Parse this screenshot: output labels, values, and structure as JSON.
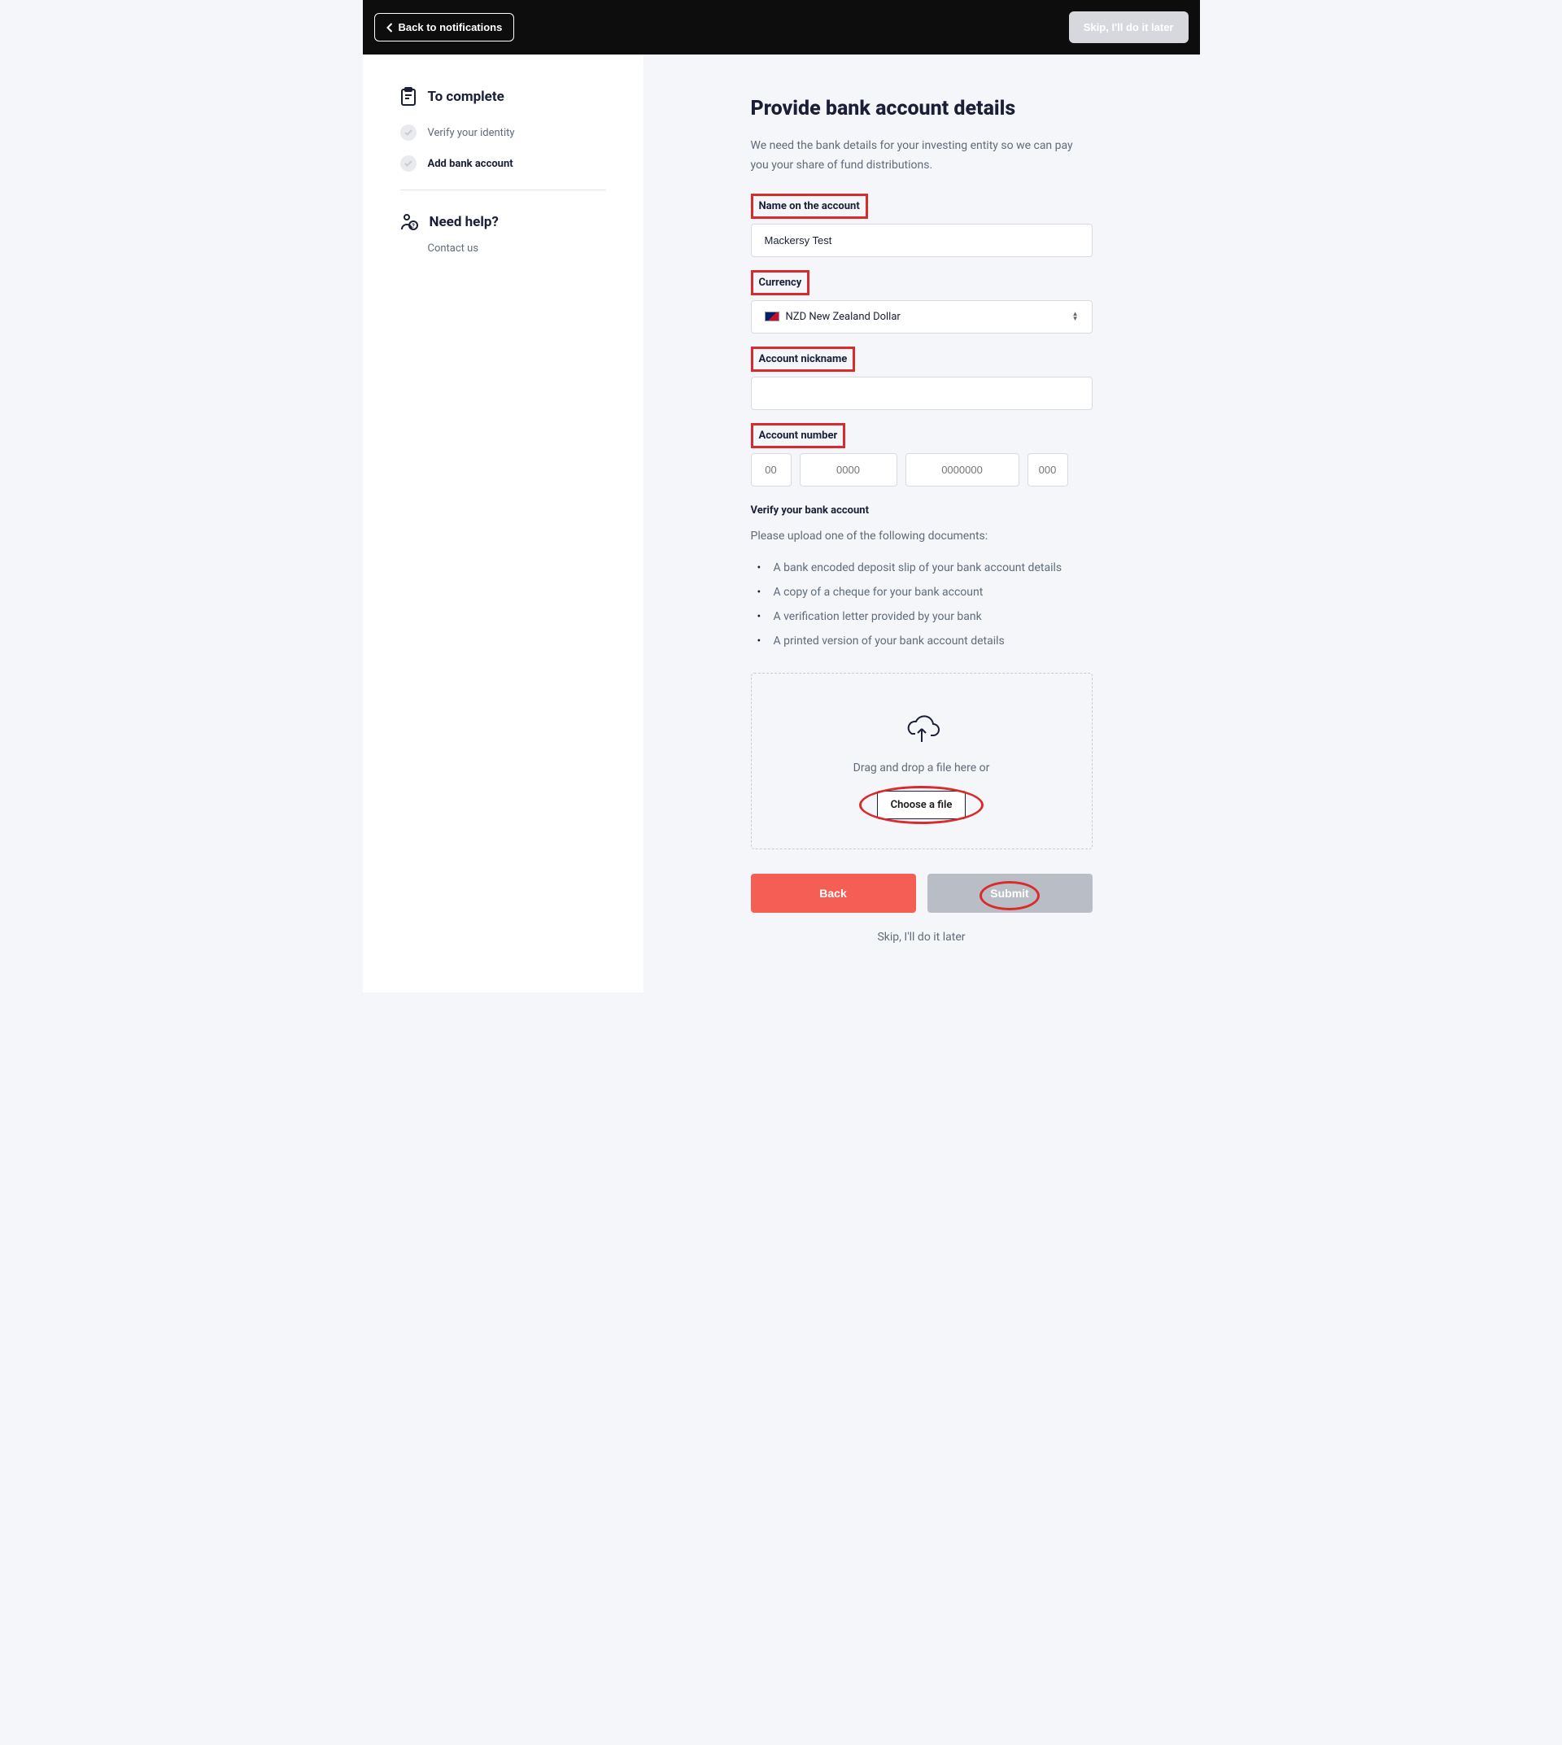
{
  "topbar": {
    "back": "Back to notifications",
    "skip": "Skip, I'll do it later"
  },
  "sidebar": {
    "complete_heading": "To complete",
    "steps": [
      {
        "label": "Verify your identity"
      },
      {
        "label": "Add bank account"
      }
    ],
    "help_heading": "Need help?",
    "contact": "Contact us"
  },
  "main": {
    "title": "Provide bank account details",
    "description": "We need the bank details for your investing entity so we can pay you your share of fund distributions.",
    "labels": {
      "name": "Name on the account",
      "currency": "Currency",
      "nickname": "Account nickname",
      "number": "Account number"
    },
    "name_value": "Mackersy Test",
    "currency_value": "NZD New Zealand Dollar",
    "number_placeholders": [
      "00",
      "0000",
      "0000000",
      "000"
    ],
    "verify_heading": "Verify your bank account",
    "upload_prompt": "Please upload one of the following documents:",
    "documents": [
      "A bank encoded deposit slip of your bank account details",
      "A copy of a cheque for your bank account",
      "A verification letter provided by your bank",
      "A printed version of your bank account details"
    ],
    "dropzone": {
      "text": "Drag and drop a file here or",
      "button": "Choose a file"
    },
    "actions": {
      "back": "Back",
      "submit": "Submit",
      "skip_link": "Skip, I'll do it later"
    }
  }
}
